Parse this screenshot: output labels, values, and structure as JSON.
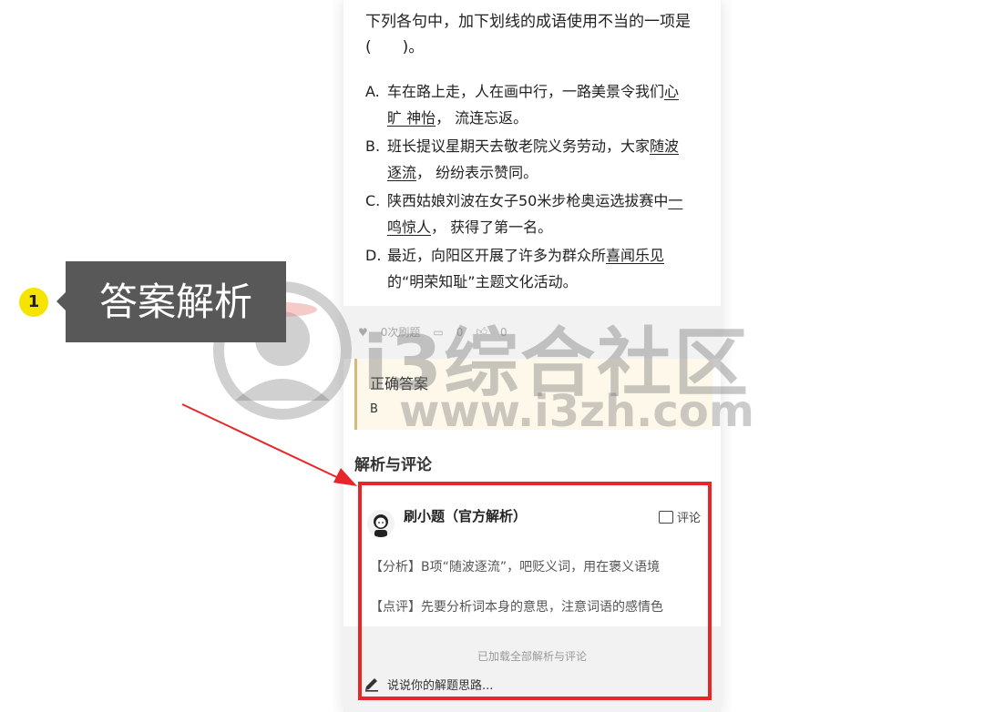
{
  "question": {
    "stem": "下列各句中，加下划线的成语使用不当的一项是(　　)。",
    "options": [
      {
        "key": "A.",
        "before": "车在路上走，人在画中行，一路美景令我们",
        "underlined": "心旷 神怡",
        "after": "， 流连忘返。"
      },
      {
        "key": "B.",
        "before": "班长提议星期天去敬老院义务劳动，大家",
        "underlined": "随波逐流",
        "after": "， 纷纷表示赞同。"
      },
      {
        "key": "C.",
        "before": "陕西姑娘刘波在女子50米步枪奥运选拔赛中",
        "underlined": "一鸣惊人",
        "after": "， 获得了第一名。"
      },
      {
        "key": "D.",
        "before": "最近，向阳区开展了许多为群众所",
        "underlined": "喜闻乐见",
        "after": "的“明荣知耻”主题文化活动。"
      }
    ]
  },
  "stats": {
    "done": "0次刷题",
    "comments": "0",
    "likes": "0"
  },
  "answer": {
    "title": "正确答案",
    "value": "B"
  },
  "analysis_section": {
    "title": "解析与评论"
  },
  "official_comment": {
    "author": "刷小题（官方解析）",
    "comment_label": "评论",
    "analysis": "【分析】B项“随波逐流”，吧贬义词，用在褒义语境",
    "review": "【点评】先要分析词本身的意思，注意词语的感情色"
  },
  "footer": {
    "loaded_text": "已加载全部解析与评论",
    "input_placeholder": "说说你的解题思路..."
  },
  "callout": {
    "step": "1",
    "text": "答案解析"
  },
  "watermark": {
    "line1": "i3综合社区",
    "line2": "www.i3zh.com"
  },
  "colors": {
    "highlight": "#e8262a",
    "badge": "#f5e300",
    "callout_bg": "#585858",
    "answer_bg": "#fdf8ea"
  }
}
